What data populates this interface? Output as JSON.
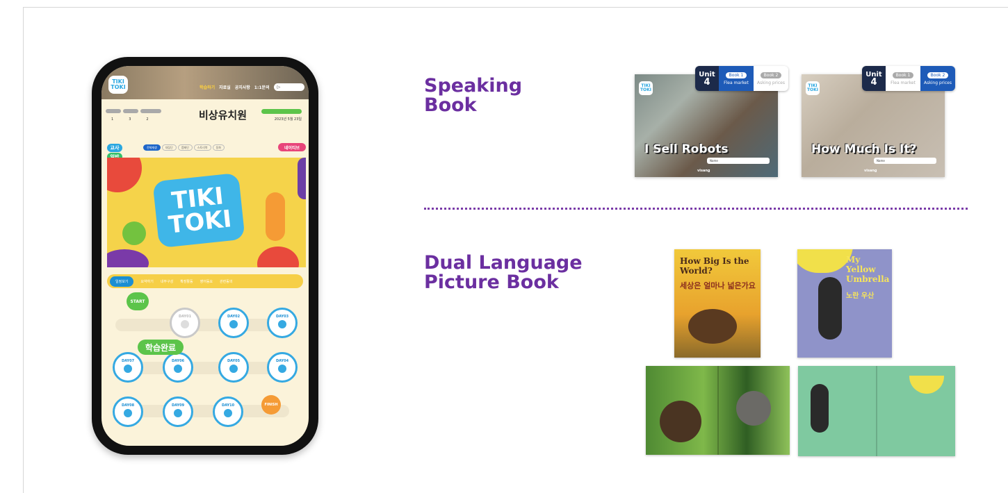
{
  "phone": {
    "logo": "TIKI TOKI",
    "menu": [
      "학습하기",
      "자료실",
      "공지사항",
      "1:1문의"
    ],
    "logout": "LOGOUT",
    "levels": [
      "1",
      "3",
      "2"
    ],
    "school": "비상유치원",
    "date": "2023년 5월 23일",
    "role_teacher": "교사",
    "role_general": "일반",
    "chips": [
      "전체재생",
      "대집단",
      "캠페인",
      "스토리북",
      "동화"
    ],
    "native": "네이티브",
    "banner_title": "TIKI TOKI",
    "tabs": [
      "일정보기",
      "요약하기",
      "내부구성",
      "확장활동",
      "영어동요",
      "관련동의"
    ],
    "start": "START",
    "finish": "FINISH",
    "complete": "학습완료",
    "days": [
      "DAY01",
      "DAY02",
      "DAY03",
      "DAY04",
      "DAY05",
      "DAY06",
      "DAY07",
      "DAY08",
      "DAY09",
      "DAY10"
    ]
  },
  "speaking": {
    "title_line1": "Speaking",
    "title_line2": "Book",
    "books": [
      {
        "title": "I Sell Robots",
        "unit_label": "Unit",
        "unit": "4",
        "book1": "Book 1",
        "book1_sub": "Flea market",
        "book2": "Book 2",
        "book2_sub": "Asking prices",
        "name": "Name",
        "brand": "visang"
      },
      {
        "title": "How Much Is It?",
        "unit_label": "Unit",
        "unit": "4",
        "book1": "Book 1",
        "book1_sub": "Flea market",
        "book2": "Book 2",
        "book2_sub": "Asking prices",
        "name": "Name",
        "brand": "visang"
      }
    ]
  },
  "dual": {
    "title_line1": "Dual Language",
    "title_line2": "Picture Book",
    "cover1_en": "How Big Is the World?",
    "cover1_ko": "세상은 얼마나 넓은가요",
    "cover2_en": "My Yellow Umbrella",
    "cover2_ko": "노란 우산"
  },
  "colors": {
    "accent": "#6b2fa0",
    "sky": "#2aa7e0",
    "green": "#5cc44a"
  }
}
